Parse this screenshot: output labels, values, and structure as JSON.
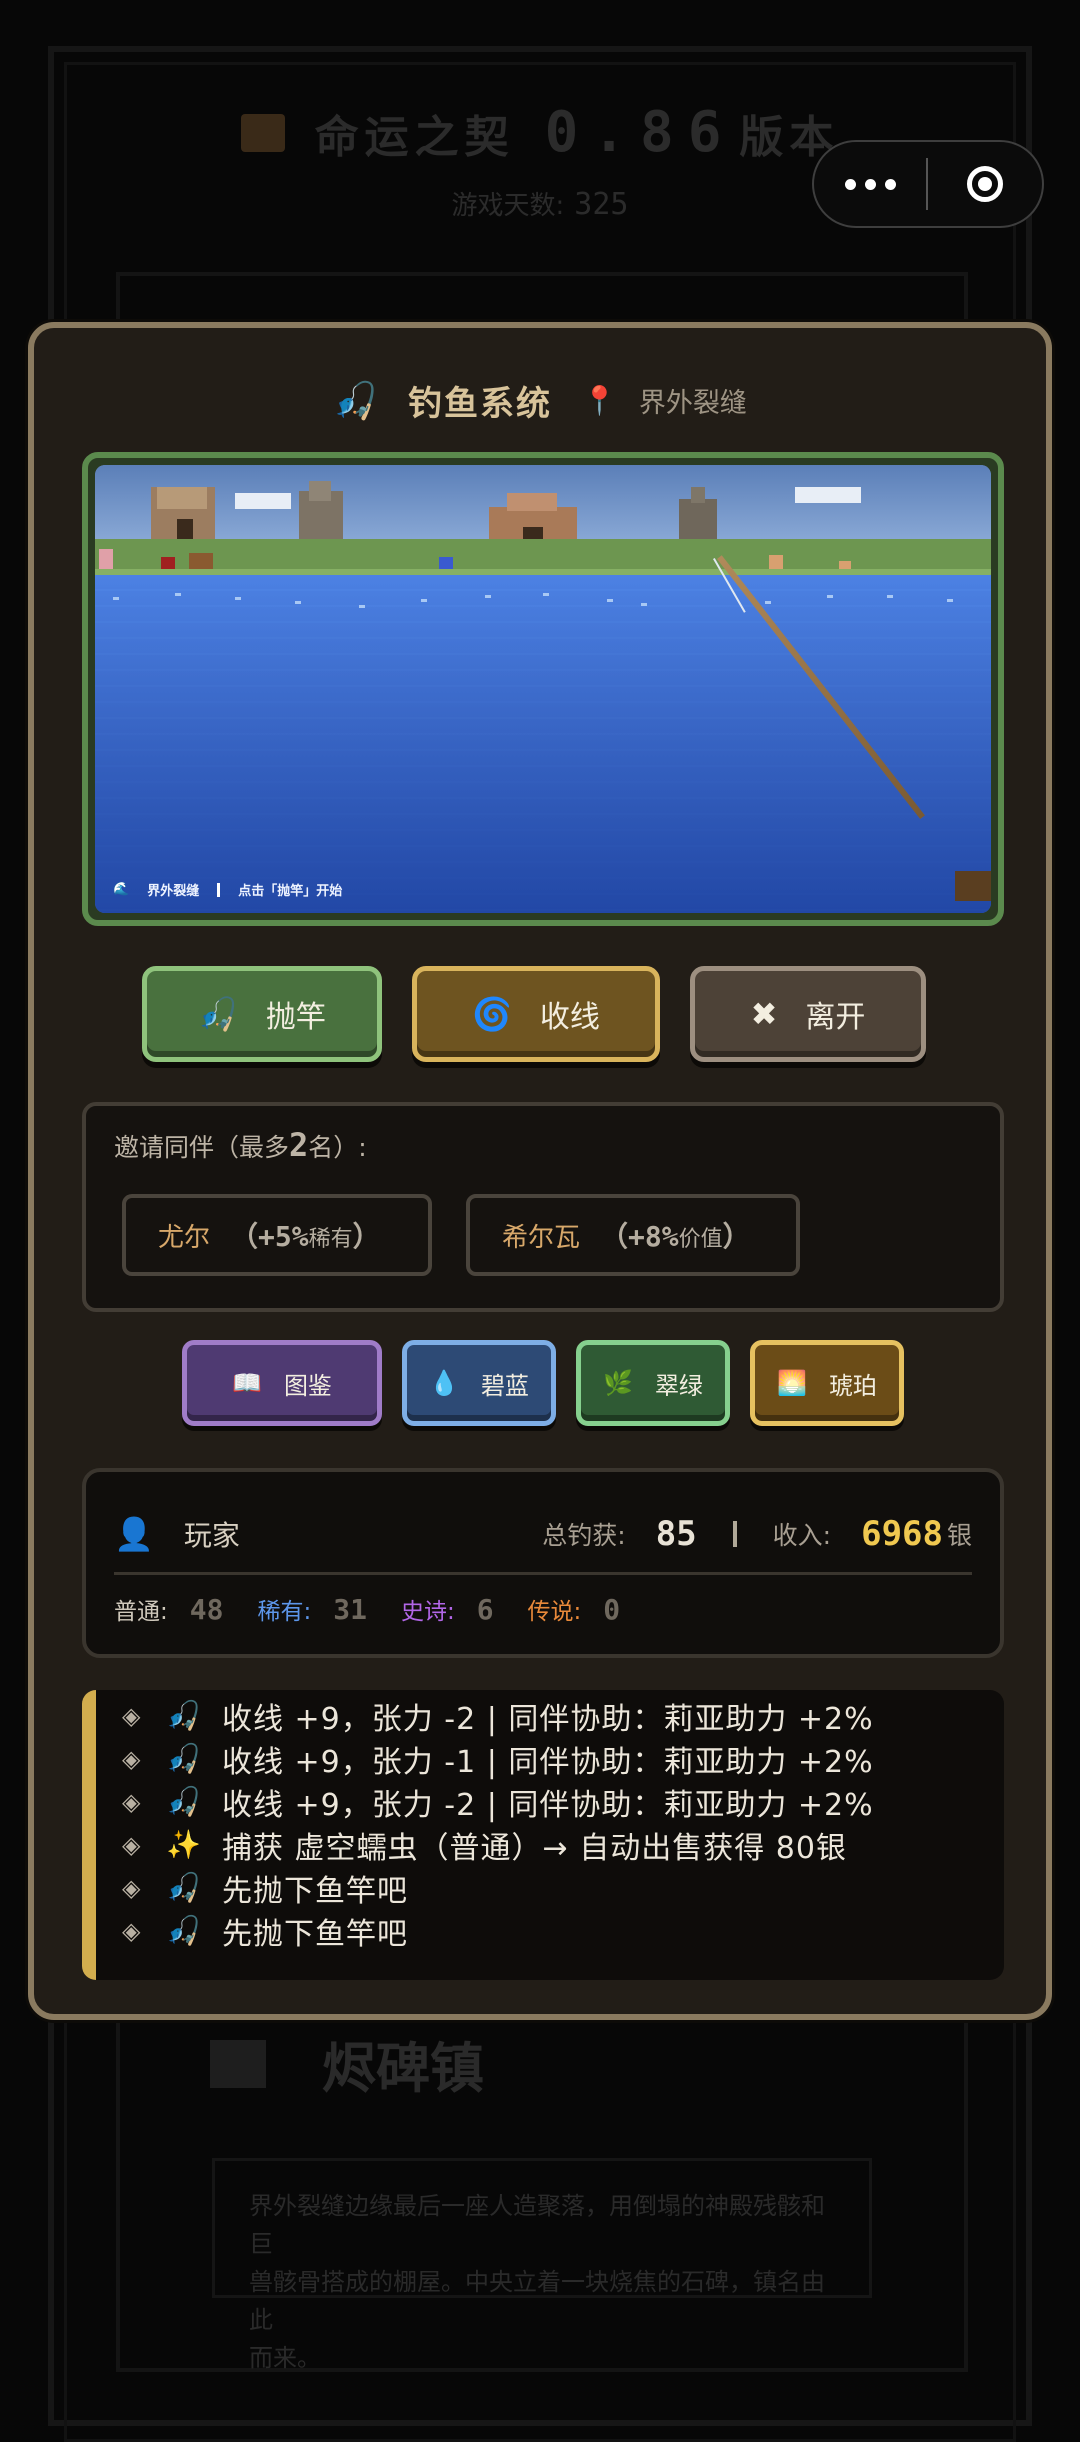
{
  "background": {
    "title": "命运之契",
    "version_number": "0.86",
    "version_suffix": "版本",
    "days_label": "游戏天数:",
    "days_value": "325",
    "town_name": "烬碑镇",
    "town_desc": [
      "界外裂缝边缘最后一座人造聚落，用倒塌的神殿残骸和巨",
      "兽骸骨搭成的棚屋。中央立着一块烧焦的石碑，镇名由此",
      "而来。"
    ]
  },
  "capsule": {
    "more_icon": "more-dots-icon",
    "close_icon": "target-close-icon"
  },
  "header": {
    "icon": "🎣",
    "title": "钓鱼系统",
    "pin_icon": "📍",
    "location": "界外裂缝"
  },
  "scene": {
    "status_icon": "🌊",
    "status_location": "界外裂缝",
    "status_hint": "点击「抛竿」开始"
  },
  "actions": {
    "cast": {
      "icon": "🎣",
      "label": "抛竿"
    },
    "reel": {
      "icon": "🌀",
      "label": "收线"
    },
    "leave": {
      "icon": "✖",
      "label": "离开"
    }
  },
  "invite": {
    "title_prefix": "邀请同伴（最多",
    "max": "2",
    "title_suffix": "名）:",
    "companions": [
      {
        "name": "尤尔",
        "bonus": "（+5%",
        "kind": "稀有",
        "close": "）"
      },
      {
        "name": "希尔瓦",
        "bonus": "（+8%",
        "kind": "价值",
        "close": "）"
      }
    ]
  },
  "tags": [
    {
      "icon": "📖",
      "label": "图鉴"
    },
    {
      "icon": "💧",
      "label": "碧蓝"
    },
    {
      "icon": "🌿",
      "label": "翠绿"
    },
    {
      "icon": "🌅",
      "label": "琥珀"
    }
  ],
  "stats": {
    "player_icon": "👤",
    "player": "玩家",
    "total_label": "总钓获:",
    "total_value": "85",
    "income_label": "收入:",
    "income_value": "6968",
    "income_unit": "银",
    "normal_label": "普通:",
    "normal_value": "48",
    "rare_label": "稀有:",
    "rare_value": "31",
    "epic_label": "史诗:",
    "epic_value": "6",
    "legend_label": "传说:",
    "legend_value": "0"
  },
  "log": [
    {
      "emoji": "🎣",
      "text": "收线 +9，张力 -2 | 同伴协助：莉亚助力 +2%"
    },
    {
      "emoji": "🎣",
      "text": "收线 +9，张力 -1 | 同伴协助：莉亚助力 +2%"
    },
    {
      "emoji": "🎣",
      "text": "收线 +9，张力 -2 | 同伴协助：莉亚助力 +2%"
    },
    {
      "emoji": "✨",
      "text": "捕获 虚空蠕虫（普通）→ 自动出售获得 80银"
    },
    {
      "emoji": "🎣",
      "text": "先抛下鱼竿吧"
    },
    {
      "emoji": "🎣",
      "text": "先抛下鱼竿吧"
    }
  ],
  "log_bullet": "◈",
  "colors": {
    "accent_gold": "#d2ad4e",
    "money": "#f0c850",
    "rare": "#5d96ea",
    "epic": "#b266e8",
    "legend": "#e8893a"
  }
}
